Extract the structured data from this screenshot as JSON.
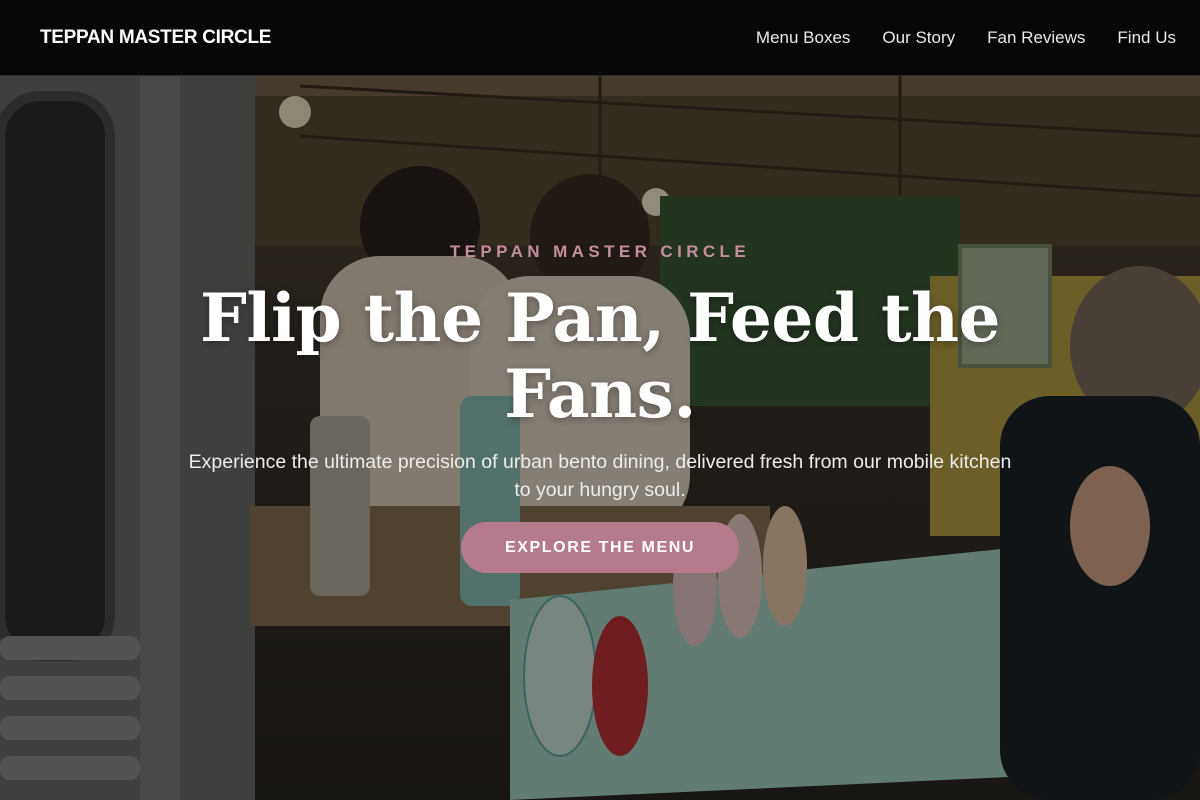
{
  "nav": {
    "brand": "TEPPAN MASTER CIRCLE",
    "links": [
      {
        "label": "Menu Boxes"
      },
      {
        "label": "Our Story"
      },
      {
        "label": "Fan Reviews"
      },
      {
        "label": "Find Us"
      }
    ]
  },
  "hero": {
    "eyebrow": "TEPPAN MASTER CIRCLE",
    "headline": "Flip the Pan, Feed the Fans.",
    "subtext": "Experience the ultimate precision of urban bento dining, delivered fresh from our mobile kitchen to your hungry soul.",
    "cta_label": "EXPLORE THE MENU",
    "background_image": "food-truck-photo"
  },
  "colors": {
    "accent": "#b57a8b",
    "eyebrow": "#c48e9d",
    "navbar_bg": "#070707"
  }
}
